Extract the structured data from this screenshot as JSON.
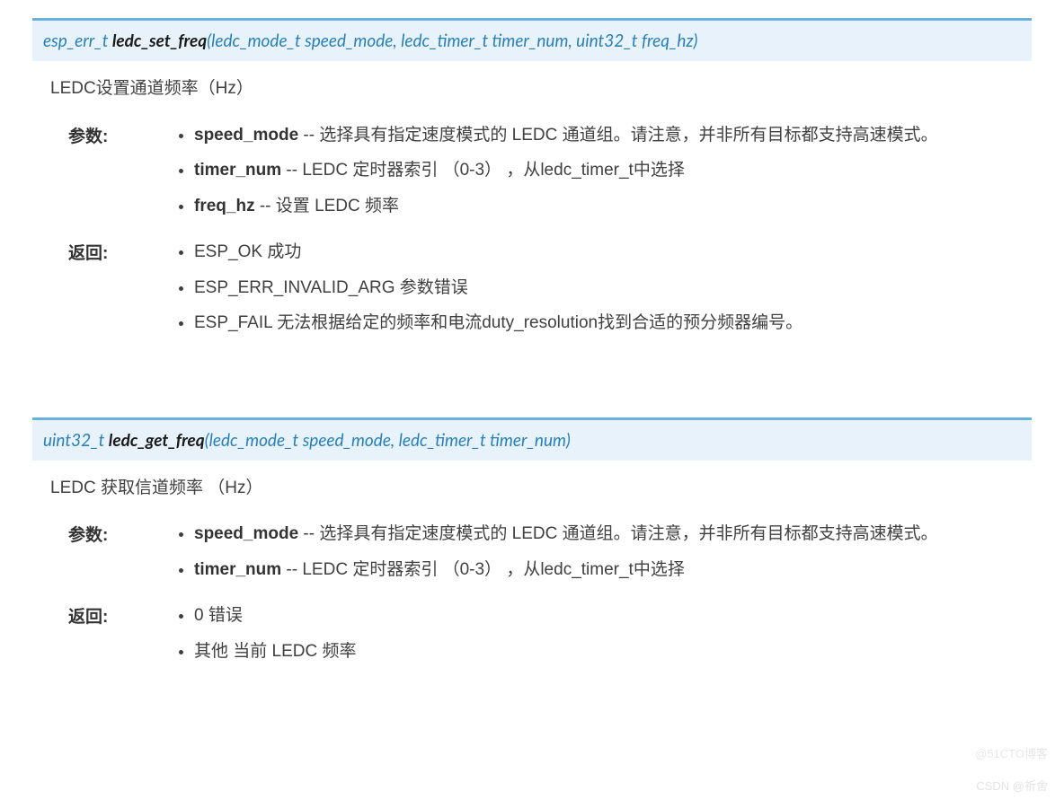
{
  "functions": [
    {
      "signature": {
        "ret": "esp_err_t ",
        "name": "ledc_set_freq",
        "args": "(ledc_mode_t speed_mode, ledc_timer_t timer_num, uint32_t freq_hz)"
      },
      "description": "LEDC设置通道频率（Hz）",
      "param_label": "参数:",
      "params": [
        {
          "name": "speed_mode",
          "text": " -- 选择具有指定速度模式的 LEDC 通道组。请注意，并非所有目标都支持高速模式。"
        },
        {
          "name": "timer_num",
          "text": " -- LEDC 定时器索引 （0-3） ，从ledc_timer_t中选择"
        },
        {
          "name": "freq_hz",
          "text": " -- 设置 LEDC 频率"
        }
      ],
      "return_label": "返回:",
      "returns": [
        "ESP_OK 成功",
        "ESP_ERR_INVALID_ARG 参数错误",
        "ESP_FAIL 无法根据给定的频率和电流duty_resolution找到合适的预分频器编号。"
      ]
    },
    {
      "signature": {
        "ret": "uint32_t ",
        "name": "ledc_get_freq",
        "args": "(ledc_mode_t speed_mode, ledc_timer_t timer_num)"
      },
      "description": "LEDC 获取信道频率 （Hz）",
      "param_label": "参数:",
      "params": [
        {
          "name": "speed_mode",
          "text": " -- 选择具有指定速度模式的 LEDC 通道组。请注意，并非所有目标都支持高速模式。"
        },
        {
          "name": "timer_num",
          "text": " -- LEDC 定时器索引 （0-3） ，从ledc_timer_t中选择"
        }
      ],
      "return_label": "返回:",
      "returns": [
        "0 错误",
        "其他 当前 LEDC 频率"
      ]
    }
  ],
  "watermark1": "@51CTO博客",
  "watermark2": "CSDN @祈舍"
}
